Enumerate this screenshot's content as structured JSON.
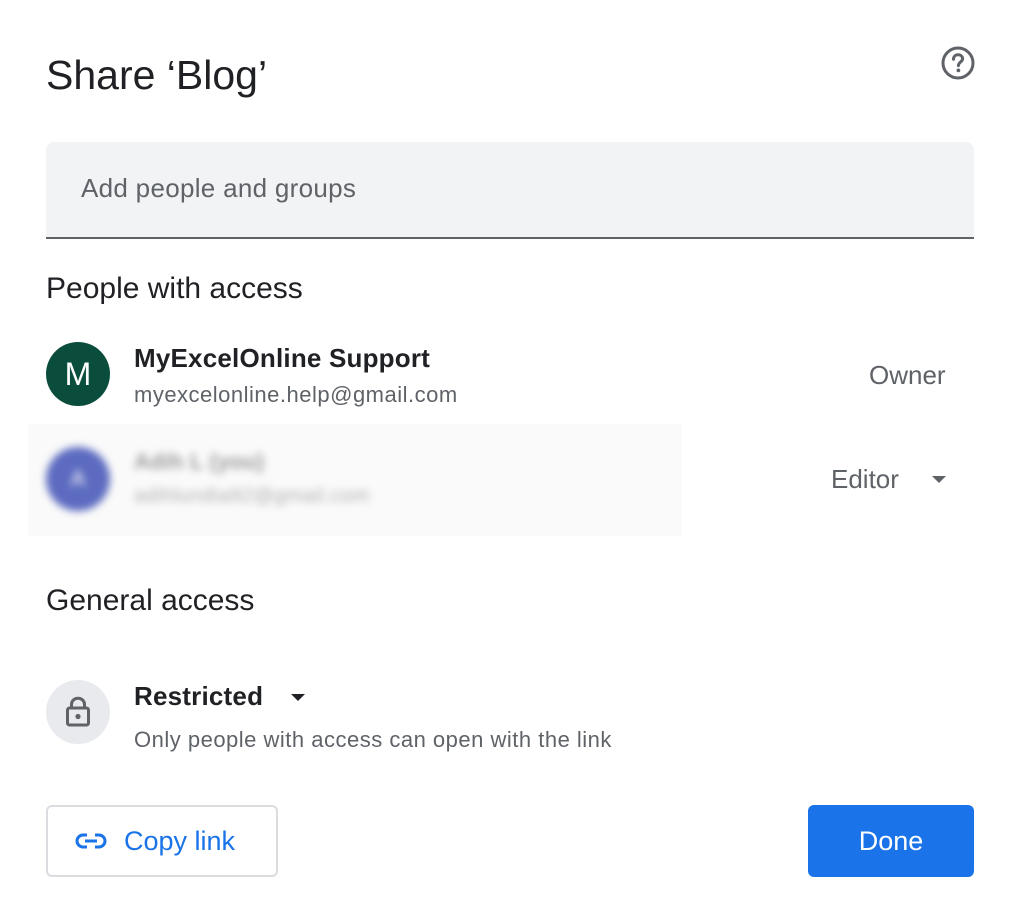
{
  "dialog": {
    "title": "Share ‘Blog’",
    "help_icon": "help-circle-icon"
  },
  "search": {
    "placeholder": "Add people and groups",
    "value": ""
  },
  "people_section": {
    "title": "People with access",
    "people": [
      {
        "initial": "M",
        "name": "MyExcelOnline Support",
        "email": "myexcelonline.help@gmail.com",
        "role": "Owner",
        "avatar_color": "#0b4d3c"
      },
      {
        "initial": "A",
        "name": "Adih L (you)",
        "email": "adihlundia92@gmail.com",
        "role": "Editor",
        "avatar_color": "#5c6bc0"
      }
    ]
  },
  "general_access": {
    "title": "General access",
    "icon": "lock-icon",
    "mode": "Restricted",
    "description": "Only people with access can open with the link"
  },
  "footer": {
    "copy_link_icon": "link-icon",
    "copy_link_label": "Copy link",
    "done_label": "Done"
  },
  "colors": {
    "accent": "#1a73e8",
    "text_primary": "#202124",
    "text_secondary": "#5f6368",
    "input_bg": "#f1f3f4"
  }
}
